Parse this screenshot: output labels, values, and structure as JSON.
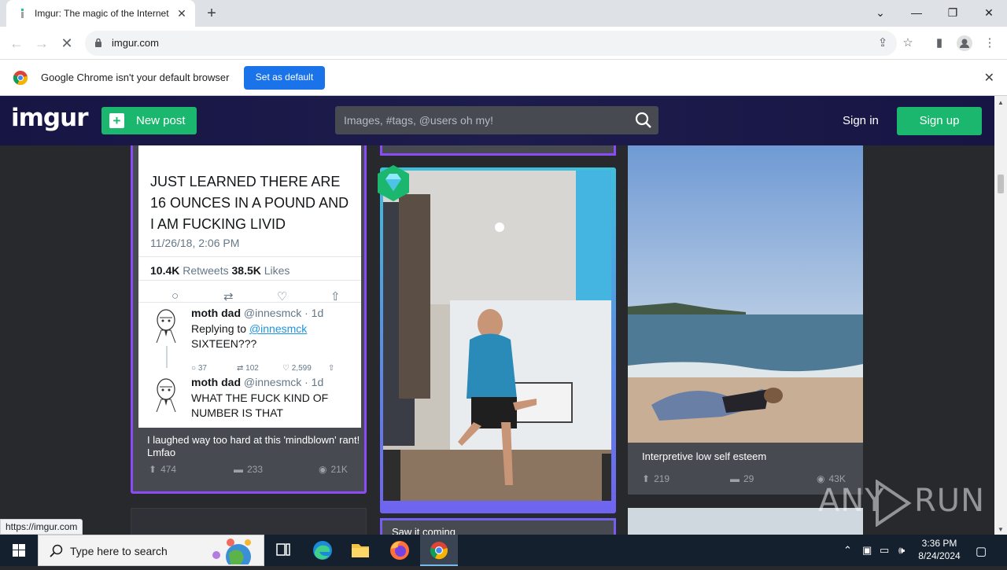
{
  "browser": {
    "tab_title": "Imgur: The magic of the Internet",
    "url": "imgur.com",
    "status_url": "https://imgur.com",
    "infobar_message": "Google Chrome isn't your default browser",
    "infobar_button": "Set as default"
  },
  "imgur": {
    "logo": "imgur",
    "new_post": "New post",
    "search_placeholder": "Images, #tags, @users oh my!",
    "sign_in": "Sign in",
    "sign_up": "Sign up"
  },
  "posts": {
    "tweet": {
      "text": "JUST LEARNED THERE ARE 16 OUNCES IN A POUND AND I AM FUCKING LIVID",
      "date": "11/26/18, 2:06 PM",
      "retweets": "10.4K",
      "retweets_label": "Retweets",
      "likes": "38.5K",
      "likes_label": "Likes",
      "reply1_name": "moth dad",
      "reply1_handle": "@innesmck · 1d",
      "reply1_replying": "Replying to",
      "reply1_mention": "@innesmck",
      "reply1_text": "SIXTEEN???",
      "reply1_comments": "37",
      "reply1_retweets": "102",
      "reply1_likes": "2,599",
      "reply2_name": "moth dad",
      "reply2_handle": "@innesmck · 1d",
      "reply2_text": "WHAT THE FUCK KIND OF NUMBER IS THAT"
    },
    "post1": {
      "caption": "I laughed way too hard at this 'mindblown' rant! Lmfao",
      "upvotes": "474",
      "comments": "233",
      "views": "21K"
    },
    "post2": {
      "caption": "Saw it coming"
    },
    "post3": {
      "caption": "Interpretive low self esteem",
      "upvotes": "219",
      "comments": "29",
      "views": "43K"
    }
  },
  "watermark": {
    "text1": "ANY",
    "text2": "RUN"
  },
  "taskbar": {
    "search_placeholder": "Type here to search",
    "time": "3:36 PM",
    "date": "8/24/2024"
  },
  "colors": {
    "imgur_green": "#1bb76e",
    "imgur_bg": "#27292d",
    "card_bg": "#474a51",
    "purple": "#8a4cf7"
  }
}
